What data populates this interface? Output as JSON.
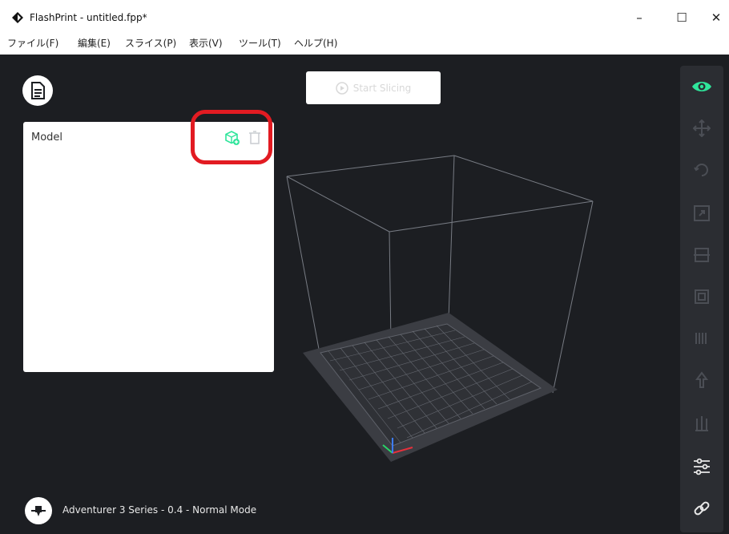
{
  "window": {
    "title": "FlashPrint - untitled.fpp*",
    "minimize_glyph": "–",
    "maximize_glyph": "☐",
    "close_glyph": "✕"
  },
  "menu": [
    "ファイル(F)",
    "編集(E)",
    "スライス(P)",
    "表示(V)",
    "ツール(T)",
    "ヘルプ(H)"
  ],
  "workspace": {
    "start_slicing_label": "Start Slicing",
    "model_panel": {
      "title": "Model",
      "actions": [
        "add-model-icon",
        "delete-icon"
      ]
    },
    "right_toolbar": {
      "tools": [
        "view-eye-icon",
        "move-icon",
        "rotate-icon",
        "scale-icon",
        "cut-icon",
        "support-icon",
        "extruder-icon",
        "print-settings-icon",
        "slicing-settings-icon",
        "preferences-sliders-icon",
        "link-icon"
      ],
      "active_tool": "view-eye-icon"
    },
    "status": "Adventurer 3 Series - 0.4 - Normal Mode"
  },
  "colors": {
    "background": "#1c1e22",
    "toolbar": "#2b2d32",
    "accent_green": "#2fe59b",
    "highlight_red": "#e21b22"
  }
}
